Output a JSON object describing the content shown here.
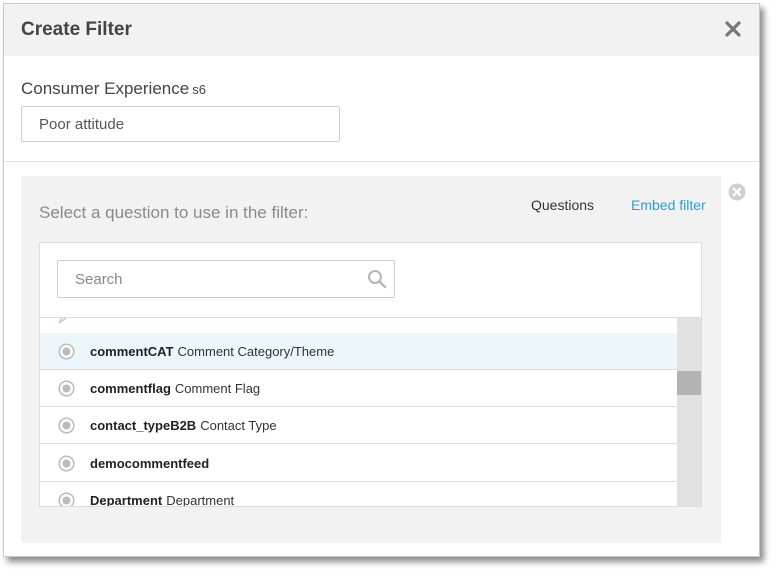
{
  "dialog": {
    "title": "Create Filter",
    "close_icon": "close-x-icon"
  },
  "filter_name": {
    "label": "Consumer Experience",
    "label_suffix": "s6",
    "value": "Poor attitude"
  },
  "question_panel": {
    "prompt": "Select a question to use in the filter:",
    "tabs": {
      "questions": "Questions",
      "embed": "Embed filter"
    },
    "search": {
      "placeholder": "Search",
      "value": ""
    },
    "questions": [
      {
        "id": "commentCAT",
        "text": "Comment Category/Theme",
        "highlighted": true
      },
      {
        "id": "commentflag",
        "text": "Comment Flag",
        "highlighted": false
      },
      {
        "id": "contact_typeB2B",
        "text": "Contact Type",
        "highlighted": false
      },
      {
        "id": "democommentfeed",
        "text": "",
        "highlighted": false
      },
      {
        "id": "Department",
        "text": "Department",
        "highlighted": false
      }
    ]
  },
  "colors": {
    "accent_link": "#2b9fd6",
    "header_bg": "#f2f2f2",
    "highlight_row": "#edf6fa",
    "radio": "#bbbbbb"
  }
}
